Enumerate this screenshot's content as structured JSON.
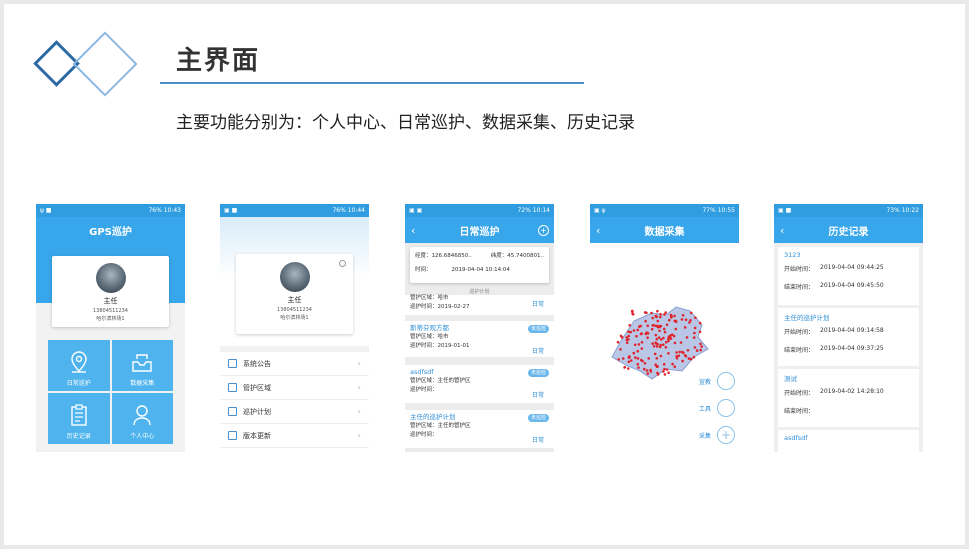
{
  "slide": {
    "title": "主界面",
    "subtitle": "主要功能分别为：个人中心、日常巡护、数据采集、历史记录"
  },
  "colors": {
    "primary": "#38a6ea",
    "status_bar": "#2f9de0",
    "tile": "#4fb4ee",
    "accent_line": "#4a90c8"
  },
  "phone1": {
    "status_left": "ψ ■",
    "status_right": "76% 10:43",
    "header": "GPS巡护",
    "user_name": "主任",
    "phone": "13804511234",
    "org": "哈尔滨林场1",
    "tiles": [
      {
        "label": "日常巡护",
        "icon": "location-pin-icon"
      },
      {
        "label": "数据采集",
        "icon": "inbox-icon"
      },
      {
        "label": "历史记录",
        "icon": "clipboard-icon"
      },
      {
        "label": "个人中心",
        "icon": "person-icon"
      }
    ]
  },
  "phone2": {
    "status_left": "▣ ■",
    "status_right": "76% 10:44",
    "user_name": "主任",
    "phone": "13804511234",
    "org": "哈尔滨林场1",
    "menu": [
      "系统公告",
      "管护区域",
      "巡护计划",
      "版本更新"
    ]
  },
  "phone3": {
    "status_left": "▣ ▣",
    "status_right": "72% 10:14",
    "header": "日常巡护",
    "lon_label": "经度：",
    "lon_value": "126.6846850..",
    "lat_label": "纬度：",
    "lat_value": "45.7400801..",
    "time_label": "时间：",
    "time_value": "2019-04-04 10:14:04",
    "section": "巡护计划",
    "partial": {
      "area": "管护区域：哈市",
      "time": "巡护时间：2019-02-27",
      "tag": "日常"
    },
    "plans": [
      {
        "name": "斯蒂芬观方都",
        "badge": "未巡检",
        "area": "管护区域：哈市",
        "time": "巡护时间：2019-01-01",
        "tag": "日常"
      },
      {
        "name": "asdfsdf",
        "badge": "未巡检",
        "area": "管护区域：主任的管护区",
        "time": "巡护时间：",
        "tag": "日常"
      },
      {
        "name": "主任的巡护计划",
        "badge": "未巡检",
        "area": "管护区域：主任的管护区",
        "time": "巡护时间：",
        "tag": "日常"
      }
    ]
  },
  "phone4": {
    "status_left": "▣ ψ",
    "status_right": "77% 10:55",
    "header": "数据采集",
    "buttons": [
      "宣教",
      "工具",
      "采集"
    ]
  },
  "phone5": {
    "status_left": "▣ ■",
    "status_right": "73% 10:22",
    "header": "历史记录",
    "start_label": "开始时间：",
    "end_label": "结束时间：",
    "records": [
      {
        "name": "3123",
        "start": "2019-04-04 09:44:25",
        "end": "2019-04-04 09:45:50"
      },
      {
        "name": "主任的巡护计划",
        "start": "2019-04-04 09:14:58",
        "end": "2019-04-04 09:37:25"
      },
      {
        "name": "测试",
        "start": "2019-04-02 14:28:10",
        "end": ""
      },
      {
        "name": "asdfsdf",
        "start": "",
        "end": ""
      }
    ]
  }
}
